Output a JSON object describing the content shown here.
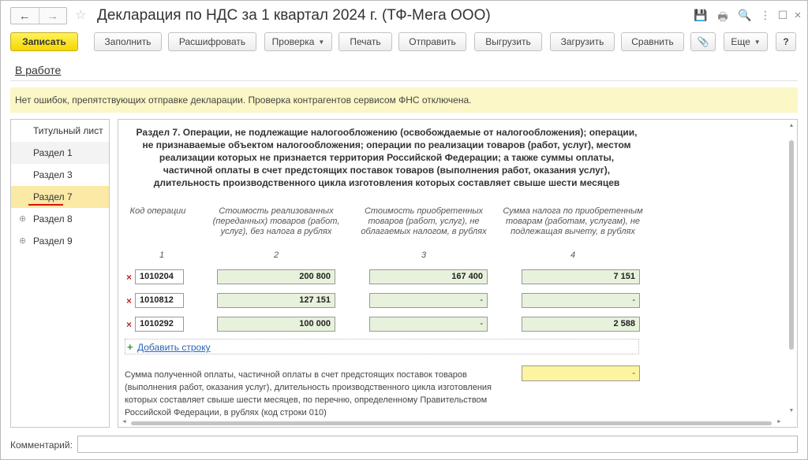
{
  "window": {
    "title": "Декларация по НДС за 1 квартал 2024 г. (ТФ-Мега ООО)",
    "back_icon": "←",
    "forward_icon": "→",
    "star_icon": "☆",
    "controls": {
      "save": "💾",
      "print": "🖶",
      "preview": "🔍",
      "more": "⋮",
      "maximize": "☐",
      "close": "×"
    }
  },
  "toolbar": {
    "record": "Записать",
    "fill": "Заполнить",
    "decode": "Расшифровать",
    "check": "Проверка",
    "print": "Печать",
    "send": "Отправить",
    "upload": "Выгрузить",
    "load": "Загрузить",
    "compare": "Сравнить",
    "attach_icon": "📎",
    "more": "Еще",
    "help": "?"
  },
  "status_link": "В работе",
  "notice": "Нет ошибок, препятствующих отправке декларации. Проверка контрагентов сервисом ФНС отключена.",
  "tree": {
    "items": [
      {
        "label": "Титульный лист"
      },
      {
        "label": "Раздел 1"
      },
      {
        "label": "Раздел 3"
      },
      {
        "label": "Раздел 7"
      },
      {
        "label": "Раздел 8",
        "expander": "⊕"
      },
      {
        "label": "Раздел 9",
        "expander": "⊕"
      }
    ]
  },
  "section": {
    "title": "Раздел 7. Операции, не подлежащие налогообложению (освобождаемые от налогообложения); операции, не признаваемые объектом налогообложения; операции по реализации товаров (работ, услуг), местом реализации которых не признается территория Российской Федерации; а также суммы оплаты, частичной оплаты в счет предстоящих поставок товаров (выполнения работ, оказания услуг), длительность производственного цикла изготовления которых составляет свыше шести месяцев",
    "columns": [
      {
        "header": "Код операции",
        "number": "1"
      },
      {
        "header": "Стоимость реализованных (переданных) товаров (работ, услуг), без налога в рублях",
        "number": "2"
      },
      {
        "header": "Стоимость приобретенных товаров (работ, услуг), не облагаемых налогом, в рублях",
        "number": "3"
      },
      {
        "header": "Сумма налога по приобретенным товарам (работам, услугам), не подлежащая вычету, в рублях",
        "number": "4"
      }
    ],
    "delete_icon": "×",
    "rows": [
      {
        "code": "1010204",
        "col2": "200 800",
        "col3": "167 400",
        "col4": "7 151"
      },
      {
        "code": "1010812",
        "col2": "127 151",
        "col3": "-",
        "col4": "-"
      },
      {
        "code": "1010292",
        "col2": "100 000",
        "col3": "-",
        "col4": "2 588"
      }
    ],
    "add_icon": "+",
    "add_row": "Добавить строку",
    "footnote": "Сумма полученной оплаты, частичной оплаты в счет предстоящих поставок товаров (выполнения работ, оказания услуг), длительность производственного цикла изготовления которых составляет свыше шести месяцев, по перечню, определенному Правительством Российской Федерации, в рублях (код строки 010)",
    "footnote_value": "-"
  },
  "scroll": {
    "up": "▲",
    "down": "▼",
    "left": "◄",
    "right": "►"
  },
  "comment": {
    "label": "Комментарий:",
    "value": ""
  },
  "colors": {
    "accent": "#f5d700",
    "selected": "#fbe9a6",
    "notice_bg": "#fbf7c6",
    "cell_bg": "#e8f1dc",
    "input_highlight": "#fcf4a0"
  }
}
